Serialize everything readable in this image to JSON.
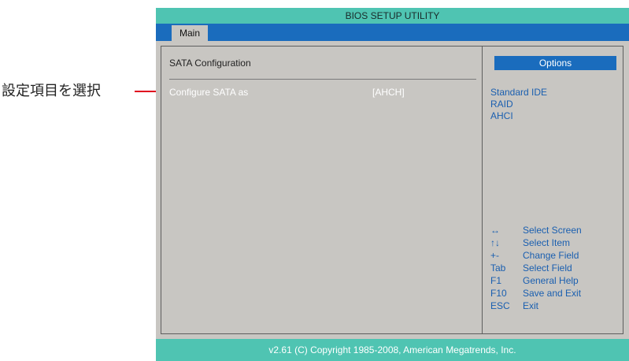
{
  "annotation": {
    "label": "設定項目を選択"
  },
  "bios": {
    "title": "BIOS SETUP UTILITY",
    "tabs": [
      {
        "label": "Main"
      }
    ],
    "section_title": "SATA  Configuration",
    "item": {
      "label": "Configure  SATA  as",
      "value": "[AHCH]"
    },
    "options_header": "Options",
    "options": [
      "Standard  IDE",
      "RAID",
      "AHCI"
    ],
    "help": [
      {
        "key": "↔",
        "desc": "Select Screen"
      },
      {
        "key": "↑↓",
        "desc": "Select Item"
      },
      {
        "key": "+-",
        "desc": "Change Field"
      },
      {
        "key": "Tab",
        "desc": "Select Field"
      },
      {
        "key": "F1",
        "desc": "General Help"
      },
      {
        "key": "F10",
        "desc": "Save and Exit"
      },
      {
        "key": "ESC",
        "desc": "Exit"
      }
    ],
    "footer": "v2.61 (C) Copyright  1985-2008, American Megatrends, Inc."
  },
  "colors": {
    "title_bar": "#4fc4b2",
    "tab_bar": "#1a6cbd",
    "panel_bg": "#c8c6c2",
    "highlight_text": "#ffffff",
    "option_text": "#1a5fb0",
    "annotation_line": "#e0001e"
  }
}
